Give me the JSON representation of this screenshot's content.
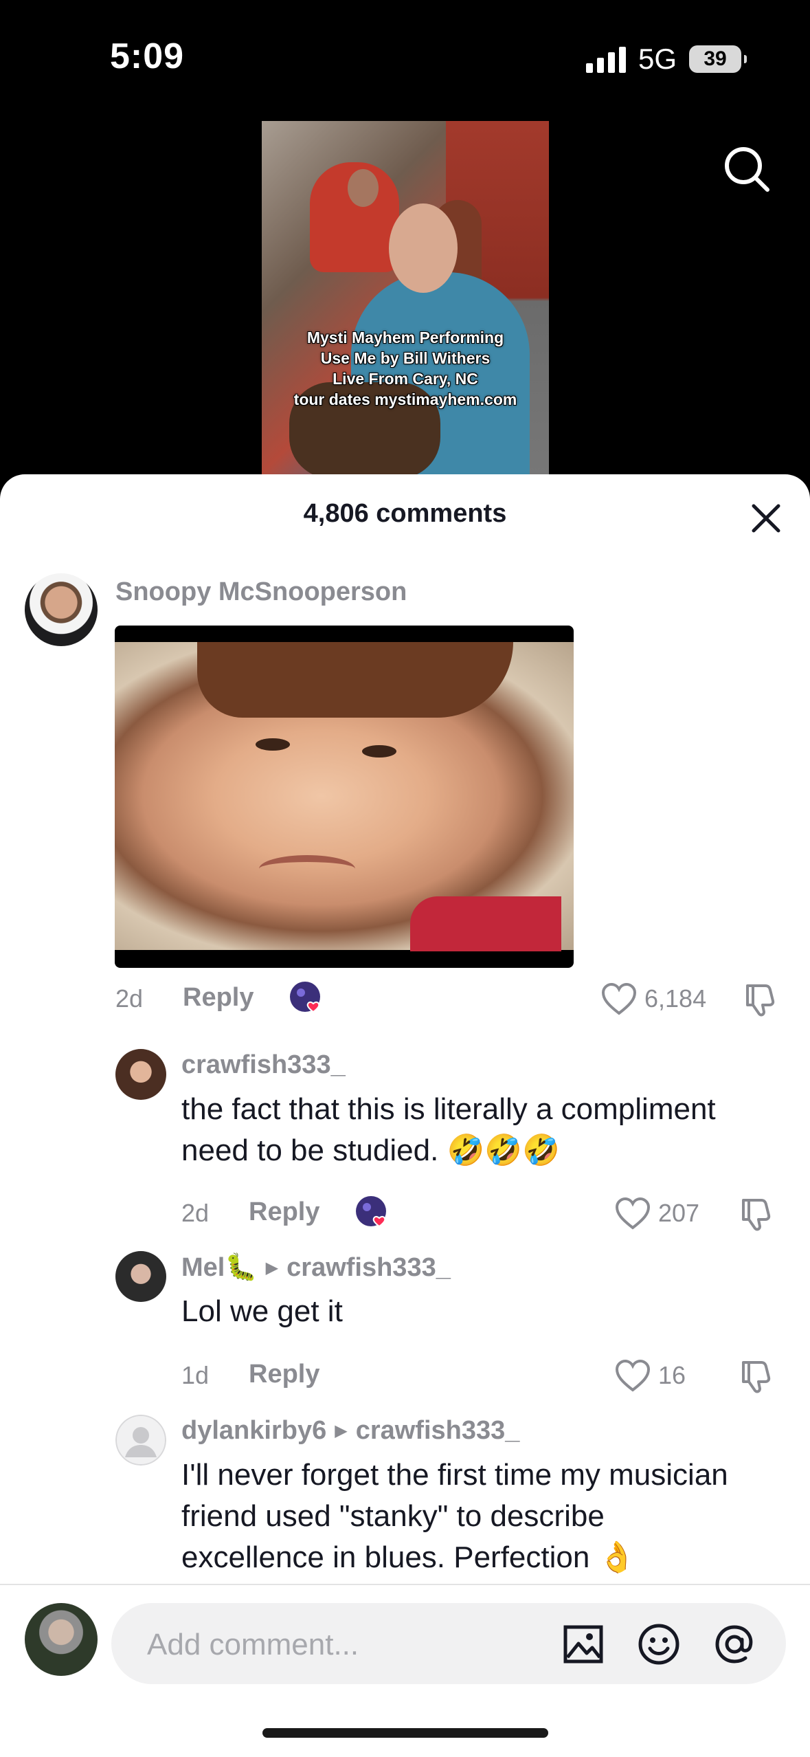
{
  "status_bar": {
    "time": "5:09",
    "network": "5G",
    "battery": "39"
  },
  "video": {
    "caption_lines": [
      "Mysti Mayhem Performing",
      "Use Me by Bill Withers",
      "Live From Cary, NC",
      "tour dates mystimayhem.com"
    ]
  },
  "comments_header": {
    "title": "4,806 comments"
  },
  "comments": [
    {
      "username": "Snoopy McSnooperson",
      "age": "2d",
      "reply_label": "Reply",
      "likes": "6,184"
    },
    {
      "username": "crawfish333_",
      "text_line1": "the fact that this is literally a compliment",
      "text_line2": "need to be studied.",
      "emoji": "🤣🤣🤣",
      "age": "2d",
      "reply_label": "Reply",
      "likes": "207"
    },
    {
      "username": "Mel🐛",
      "reply_to": "crawfish333_",
      "text": "Lol we get it",
      "age": "1d",
      "reply_label": "Reply",
      "likes": "16"
    },
    {
      "username": "dylankirby6",
      "reply_to": "crawfish333_",
      "text_line1": "I'll never forget the first time my musician",
      "text_line2": "friend used \"stanky\" to describe",
      "text_line3": "excellence in blues. Perfection",
      "emoji": "👌"
    }
  ],
  "composer": {
    "placeholder": "Add comment..."
  },
  "colors": {
    "text_primary": "#161823",
    "text_secondary": "#8a8b91",
    "like_badge": "#fe2c55",
    "input_bg": "#f1f1f2"
  }
}
